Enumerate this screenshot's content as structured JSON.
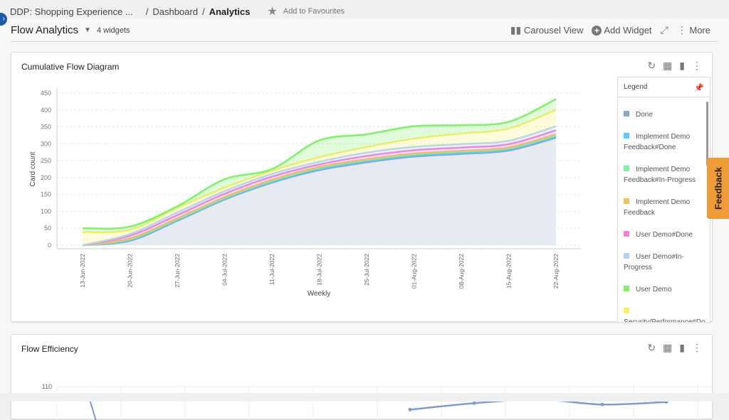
{
  "breadcrumb": {
    "project": "DDP: Shopping Experience ...",
    "sep": "/",
    "dashboard": "Dashboard",
    "current": "Analytics",
    "favourite": "Add to Favourites"
  },
  "header": {
    "title": "Flow Analytics",
    "widget_count": "4 widgets",
    "carousel": "Carousel View",
    "add_widget": "Add Widget",
    "more": "More"
  },
  "feedback": "Feedback",
  "widgets": [
    {
      "title": "Cumulative Flow Diagram"
    },
    {
      "title": "Flow Efficiency"
    }
  ],
  "legend": {
    "title": "Legend",
    "items": [
      {
        "label": "Done",
        "color": "#8fa5c8"
      },
      {
        "label": "Implement Demo Feedback#Done",
        "color": "#5bc8f5"
      },
      {
        "label": "Implement Demo Feedback#In-Progress",
        "color": "#7ef0a8"
      },
      {
        "label": "Implement Demo Feedback",
        "color": "#f5bf5a"
      },
      {
        "label": "User Demo#Done",
        "color": "#ee82d8"
      },
      {
        "label": "User Demo#In-Progress",
        "color": "#b0d4f5"
      },
      {
        "label": "User Demo",
        "color": "#7ef06a"
      },
      {
        "label": "Security/Performance#Done",
        "color": "#f8ef6a"
      }
    ]
  },
  "chart_data": [
    {
      "type": "area",
      "stacked": true,
      "title": "Cumulative Flow Diagram",
      "xlabel": "Weekly",
      "ylabel": "Card count",
      "ylim": [
        0,
        450
      ],
      "yticks": [
        0,
        50,
        100,
        150,
        200,
        250,
        300,
        350,
        400,
        450
      ],
      "grid": "horizontal dashed",
      "legend": "right",
      "categories": [
        "13-Jun-2022",
        "20-Jun-2022",
        "27-Jun-2022",
        "04-Jul-2022",
        "11-Jul-2022",
        "18-Jul-2022",
        "25-Jul-2022",
        "01-Aug-2022",
        "08-Aug-2022",
        "15-Aug-2022",
        "22-Aug-2022"
      ],
      "series": [
        {
          "name": "Done",
          "values": [
            0,
            13,
            72,
            135,
            185,
            222,
            245,
            262,
            270,
            280,
            318
          ]
        },
        {
          "name": "Implement Demo Feedback#Done",
          "values": [
            0,
            2,
            2,
            2,
            2,
            3,
            3,
            3,
            3,
            3,
            3
          ]
        },
        {
          "name": "Implement Demo Feedback#In-Progress",
          "values": [
            0,
            3,
            3,
            3,
            4,
            4,
            4,
            4,
            4,
            4,
            4
          ]
        },
        {
          "name": "Implement Demo Feedback",
          "values": [
            0,
            2,
            2,
            2,
            2,
            2,
            2,
            2,
            2,
            2,
            3
          ]
        },
        {
          "name": "User Demo#Done",
          "values": [
            0,
            8,
            10,
            10,
            10,
            8,
            10,
            10,
            10,
            10,
            12
          ]
        },
        {
          "name": "User Demo#In-Progress",
          "values": [
            0,
            5,
            8,
            8,
            8,
            8,
            10,
            10,
            10,
            10,
            12
          ]
        },
        {
          "name": "Security/Performance#Done",
          "values": [
            38,
            12,
            13,
            10,
            9,
            13,
            16,
            24,
            31,
            36,
            48
          ]
        },
        {
          "name": "User Demo",
          "values": [
            12,
            10,
            5,
            25,
            5,
            50,
            38,
            37,
            25,
            20,
            32
          ]
        }
      ]
    },
    {
      "type": "line",
      "title": "Flow Efficiency",
      "yticks": [
        100,
        110
      ],
      "color": "#7f9cc8",
      "values": [
        100,
        null,
        null,
        null,
        null,
        92,
        97,
        100,
        96,
        98
      ]
    }
  ]
}
